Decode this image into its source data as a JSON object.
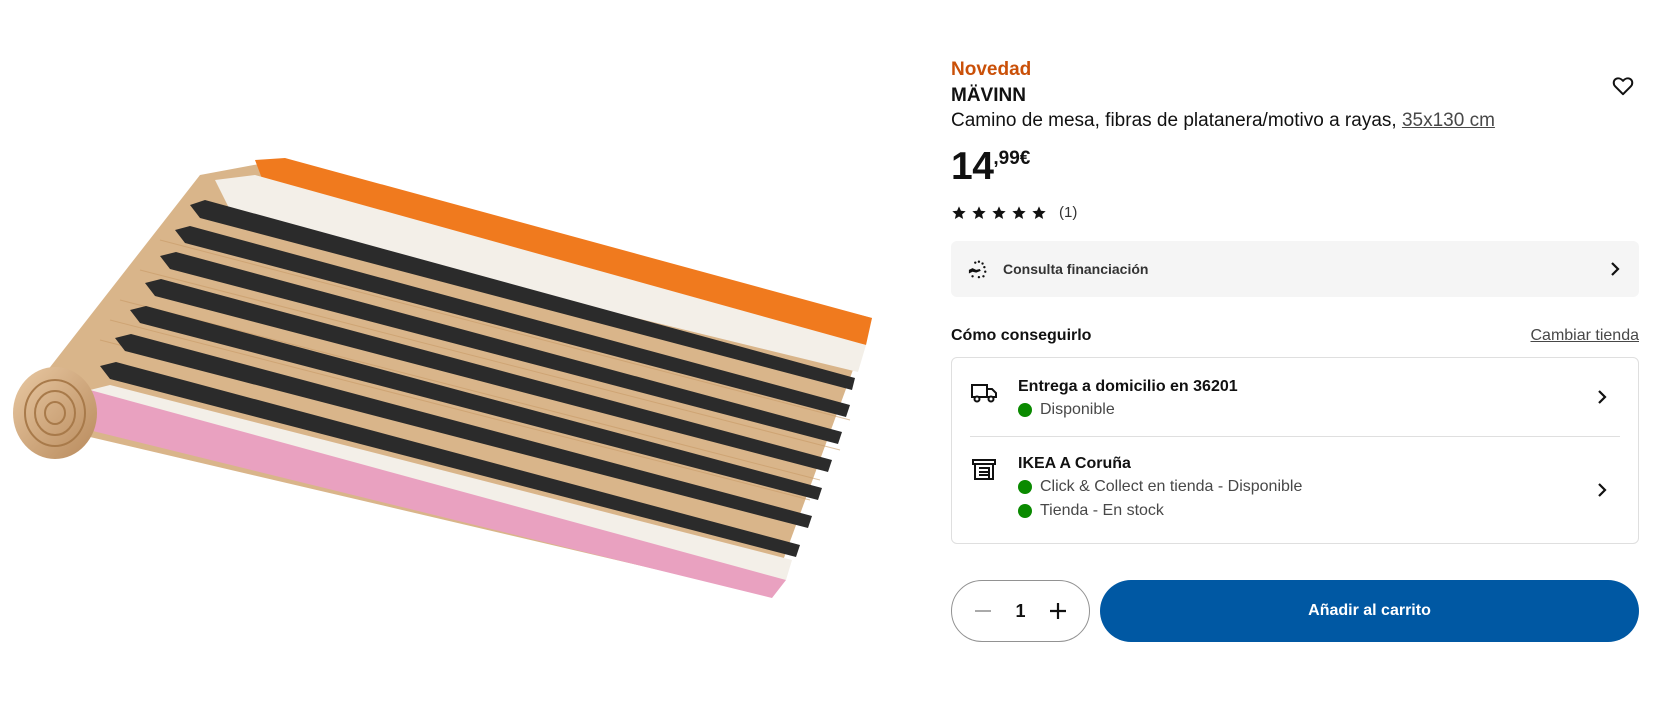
{
  "product": {
    "badge": "Novedad",
    "name": "MÄVINN",
    "description": "Camino de mesa, fibras de platanera/motivo a rayas,",
    "size_link": "35x130 cm",
    "price_int": "14",
    "price_dec": ",99€",
    "rating_value": 5,
    "rating_count": "(1)"
  },
  "financing": {
    "label": "Consulta financiación"
  },
  "availability": {
    "title": "Cómo conseguirlo",
    "change_store": "Cambiar tienda",
    "delivery": {
      "title": "Entrega a domicilio en 36201",
      "status": "Disponible"
    },
    "store": {
      "title": "IKEA A Coruña",
      "status_1": "Click & Collect en tienda - Disponible",
      "status_2": "Tienda - En stock"
    },
    "status_color": "#0a8a00"
  },
  "cart": {
    "quantity": "1",
    "add_label": "Añadir al carrito",
    "button_color": "#0058a3"
  },
  "icons": [
    "heart-icon",
    "star-icon",
    "financing-icon",
    "chevron-right-icon",
    "truck-icon",
    "store-icon",
    "minus-icon",
    "plus-icon"
  ]
}
